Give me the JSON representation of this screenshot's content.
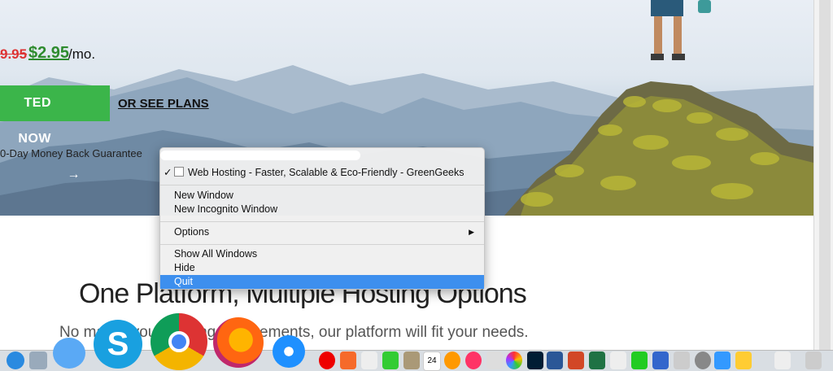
{
  "hero": {
    "price_old": "9.95",
    "price_new": "$2.95",
    "price_unit": "/mo.",
    "cta_label": "TED NOW",
    "cta_arrow": "→",
    "see_plans_label": "OR SEE PLANS",
    "guarantee": "0-Day Money Back Guarantee"
  },
  "content": {
    "headline": "One Platform, Multiple Hosting Options",
    "subline": "No matter your hosting requirements, our platform will fit your needs."
  },
  "menu": {
    "checked_window": "Web Hosting - Faster, Scalable & Eco-Friendly - GreenGeeks",
    "check_mark": "✓",
    "new_window": "New Window",
    "new_incognito": "New Incognito Window",
    "options": "Options",
    "submenu_arrow": "▶",
    "show_all": "Show All Windows",
    "hide": "Hide",
    "quit": "Quit"
  },
  "dock": {
    "icons": [
      "app-store-icon",
      "preview-icon",
      "messages-icon",
      "skype-icon",
      "chrome-icon",
      "firefox-icon",
      "safari-icon",
      "opera-icon",
      "brave-icon",
      "app-icon-1",
      "facetime-icon",
      "app-icon-2",
      "calendar-icon",
      "ibooks-icon",
      "music-icon",
      "photos-icon",
      "photoshop-icon",
      "word-icon",
      "powerpoint-icon",
      "excel-icon",
      "app-icon-3",
      "numbers-icon",
      "keynote-icon",
      "app-icon-4",
      "system-preferences-icon",
      "app-icon-5",
      "app-icon-6",
      "app-icon-7",
      "trash-icon"
    ],
    "calendar_day": "24"
  },
  "colors": {
    "cta_green": "#3bb54a",
    "price_green": "#2e8b2e",
    "price_red": "#dd3333",
    "menu_highlight": "#3d8fee"
  }
}
